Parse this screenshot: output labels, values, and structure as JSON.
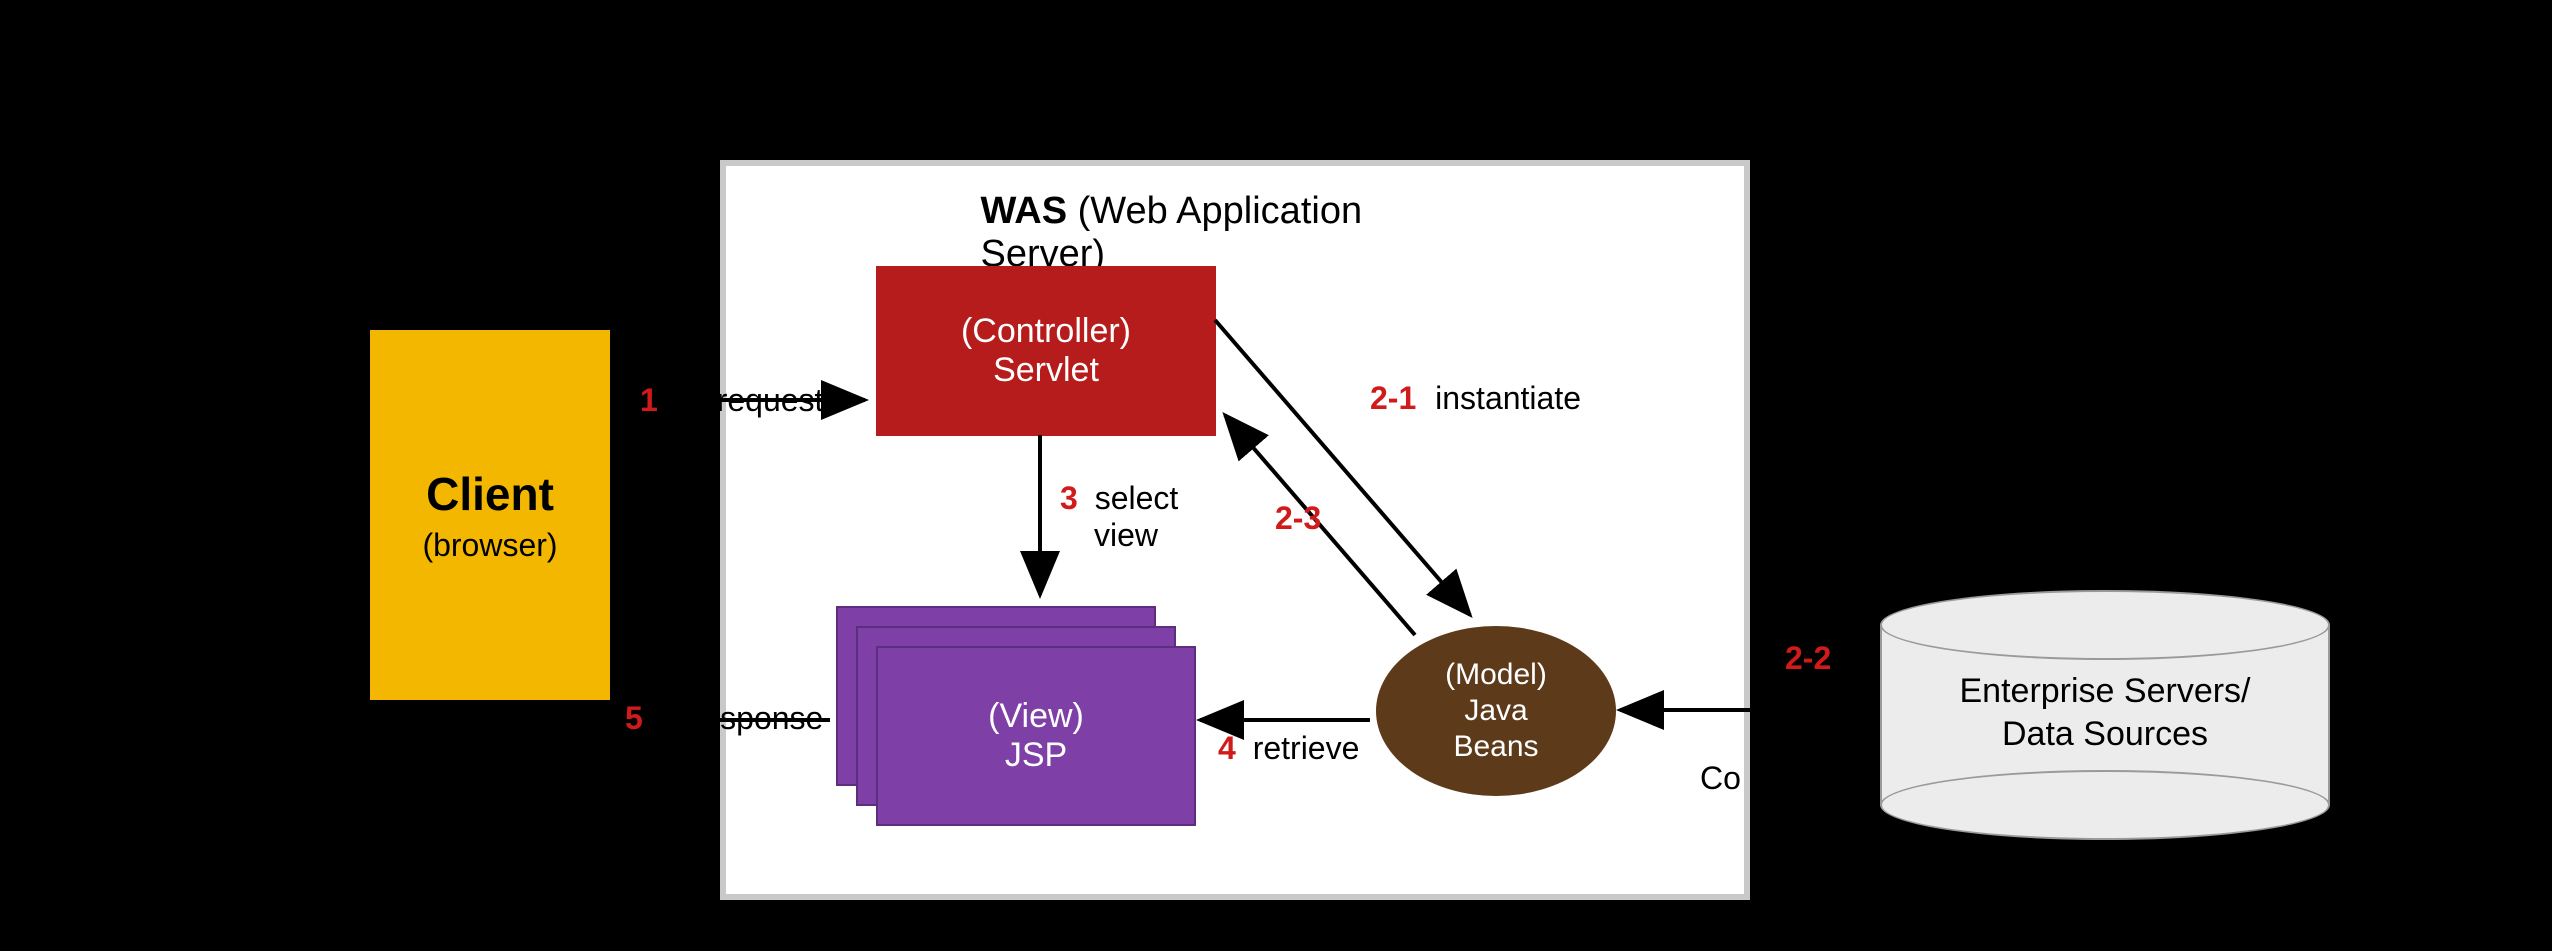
{
  "client": {
    "title": "Client",
    "subtitle": "(browser)"
  },
  "was": {
    "title_bold": "WAS",
    "title_rest": " (Web Application Server)"
  },
  "controller": {
    "line1": "(Controller)",
    "line2": "Servlet"
  },
  "view": {
    "line1": "(View)",
    "line2": "JSP"
  },
  "model": {
    "line1": "(Model)",
    "line2": "Java",
    "line3": "Beans"
  },
  "db": {
    "line1": "Enterprise Servers/",
    "line2": "Data Sources"
  },
  "steps": {
    "s1": {
      "num": "1",
      "text": "request"
    },
    "s21": {
      "num": "2-1",
      "text": "instantiate"
    },
    "s22": {
      "num": "2-2",
      "text": ""
    },
    "s22tail": "Co",
    "s23": {
      "num": "2-3",
      "text": ""
    },
    "s3": {
      "num": "3",
      "text": "select",
      "text2": "view"
    },
    "s4": {
      "num": "4",
      "text": "retrieve"
    },
    "s5": {
      "num": "5",
      "text": "response"
    }
  }
}
